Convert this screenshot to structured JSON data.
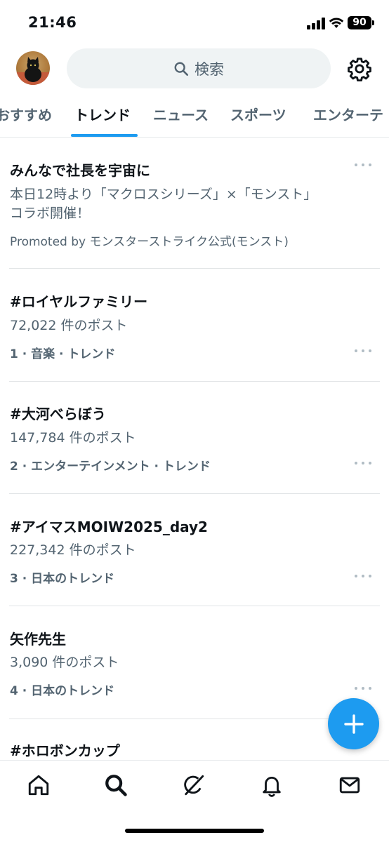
{
  "status_bar": {
    "time": "21:46",
    "battery": "90"
  },
  "header": {
    "search_placeholder": "検索"
  },
  "tabs": [
    {
      "label": "おすすめ",
      "active": false
    },
    {
      "label": "トレンド",
      "active": true
    },
    {
      "label": "ニュース",
      "active": false
    },
    {
      "label": "スポーツ",
      "active": false
    },
    {
      "label": "エンターテ",
      "active": false
    }
  ],
  "trends": [
    {
      "title": "みんなで社長を宇宙に",
      "description_line1": "本日12時より「マクロスシリーズ」×「モンスト」",
      "description_line2": "コラボ開催！",
      "promoted": "Promoted by モンスターストライク公式(モンスト)"
    },
    {
      "title": "#ロイヤルファミリー",
      "posts": "72,022 件のポスト",
      "meta": "1 · 音楽 · トレンド"
    },
    {
      "title": "#大河べらぼう",
      "posts": "147,784 件のポスト",
      "meta": "2 · エンターテインメント · トレンド"
    },
    {
      "title": "#アイマスMOIW2025_day2",
      "posts": "227,342 件のポスト",
      "meta": "3 · 日本のトレンド"
    },
    {
      "title": "矢作先生",
      "posts": "3,090 件のポスト",
      "meta": "4 · 日本のトレンド"
    },
    {
      "title": "#ホロボンカップ"
    }
  ],
  "icons": {
    "search": "search-icon",
    "settings": "gear-icon",
    "more": "more-icon",
    "compose": "plus-icon",
    "home": "home-icon",
    "explore": "search-icon",
    "grok": "grok-icon",
    "notifications": "bell-icon",
    "messages": "envelope-icon"
  },
  "colors": {
    "accent": "#1d9bf0",
    "text": "#0f1419",
    "secondary": "#536471"
  }
}
